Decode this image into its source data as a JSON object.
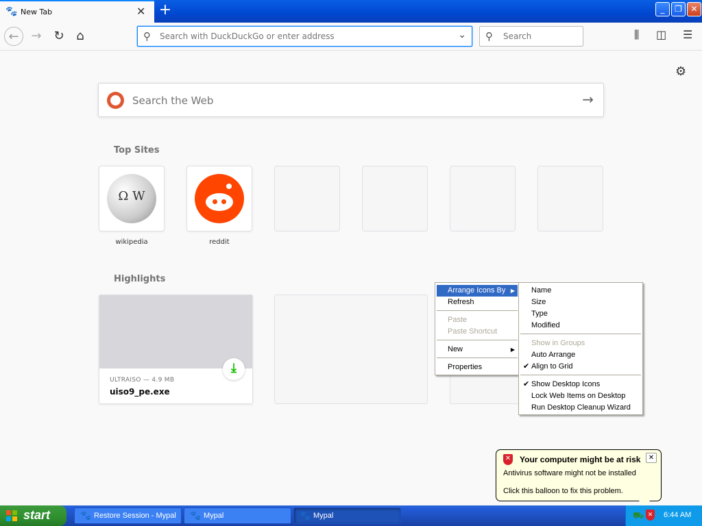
{
  "window": {
    "tab_title": "New Tab",
    "tab_close": "✕",
    "new_tab": "+",
    "minimize": "_",
    "maximize": "❐",
    "close": "✕"
  },
  "toolbar": {
    "back": "←",
    "forward": "→",
    "reload": "↻",
    "home": "⌂",
    "url_placeholder": "Search with DuckDuckGo or enter address",
    "url_value": "",
    "search_placeholder": "Search",
    "library_icon": "library-icon",
    "sidebar_icon": "sidebar-icon",
    "menu_icon": "hamburger-menu-icon"
  },
  "newtab": {
    "search_placeholder": "Search the Web",
    "top_sites_title": "Top Sites",
    "top_sites": [
      {
        "label": "wikipedia",
        "icon": "wikipedia-globe-icon"
      },
      {
        "label": "reddit",
        "icon": "reddit-alien-icon"
      },
      {
        "label": ""
      },
      {
        "label": ""
      },
      {
        "label": ""
      },
      {
        "label": ""
      }
    ],
    "highlights_title": "Highlights",
    "highlights": [
      {
        "meta": "ULTRAISO — 4.9 MB",
        "name": "uiso9_pe.exe",
        "badge": "download-icon"
      }
    ]
  },
  "context_menu": {
    "items": [
      {
        "label": "Arrange Icons By",
        "submenu": true,
        "highlighted": true
      },
      {
        "label": "Refresh"
      },
      {
        "label": "Paste",
        "disabled": true
      },
      {
        "label": "Paste Shortcut",
        "disabled": true
      },
      {
        "label": "New",
        "submenu": true
      },
      {
        "label": "Properties"
      }
    ]
  },
  "submenu": {
    "items": [
      {
        "label": "Name"
      },
      {
        "label": "Size"
      },
      {
        "label": "Type"
      },
      {
        "label": "Modified"
      },
      {
        "label": "Show in Groups",
        "disabled": true
      },
      {
        "label": "Auto Arrange"
      },
      {
        "label": "Align to Grid",
        "checked": true
      },
      {
        "label": "Show Desktop Icons",
        "checked": true
      },
      {
        "label": "Lock Web Items on Desktop"
      },
      {
        "label": "Run Desktop Cleanup Wizard"
      }
    ]
  },
  "balloon": {
    "title": "Your computer might be at risk",
    "line1": "Antivirus software might not be installed",
    "line2": "Click this balloon to fix this problem.",
    "close": "✕"
  },
  "taskbar": {
    "start": "start",
    "tasks": [
      {
        "label": "Restore Session - Mypal",
        "active": false
      },
      {
        "label": "Mypal",
        "active": false
      },
      {
        "label": "Mypal",
        "active": true
      }
    ],
    "clock": "6:44 AM"
  },
  "colors": {
    "accent": "#0a84ff",
    "menu_highlight": "#316ac5",
    "start_green": "#2f8f2f",
    "taskbar_blue": "#245edb",
    "reddit_orange": "#ff4500",
    "ddg_orange": "#de5833",
    "download_green": "#12bc00",
    "balloon_bg": "#ffffe1"
  }
}
